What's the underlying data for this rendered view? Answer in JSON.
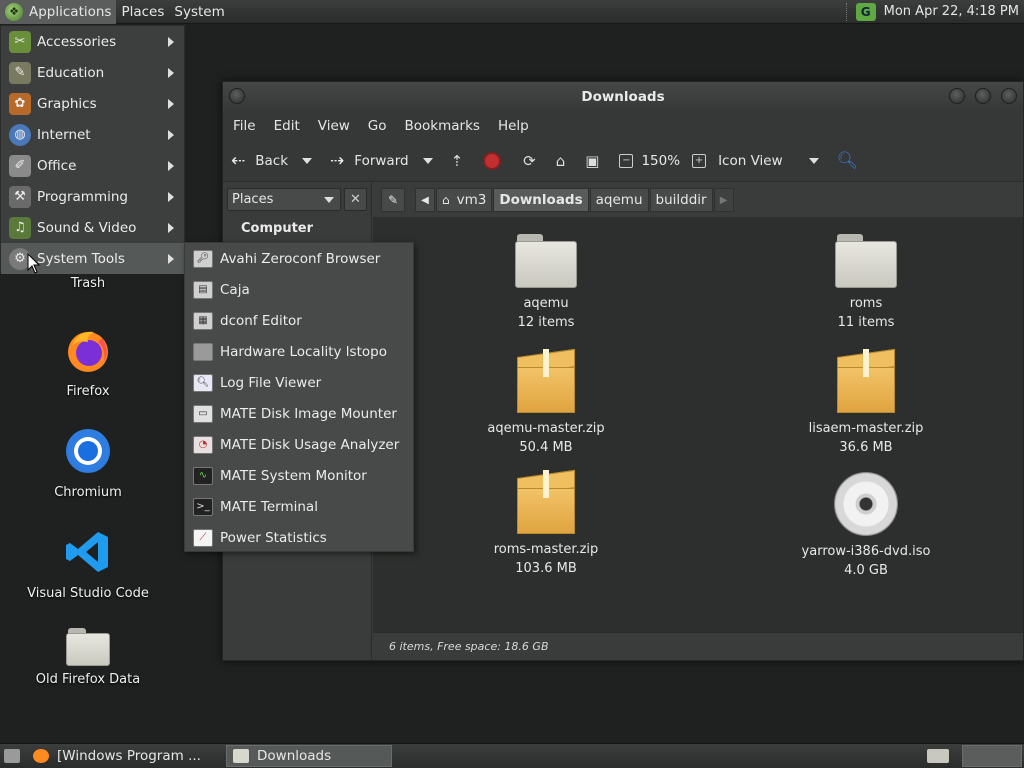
{
  "top_panel": {
    "menus": [
      "Applications",
      "Places",
      "System"
    ],
    "clock": "Mon Apr 22,  4:18 PM"
  },
  "desktop": {
    "icons": [
      {
        "label": "Trash"
      },
      {
        "label": "Firefox"
      },
      {
        "label": "Chromium"
      },
      {
        "label": "Visual Studio Code"
      },
      {
        "label": "Old Firefox Data"
      }
    ]
  },
  "app_menu": {
    "items": [
      {
        "label": "Accessories",
        "icon": "accessories-icon"
      },
      {
        "label": "Education",
        "icon": "education-icon"
      },
      {
        "label": "Graphics",
        "icon": "graphics-icon"
      },
      {
        "label": "Internet",
        "icon": "internet-icon"
      },
      {
        "label": "Office",
        "icon": "office-icon"
      },
      {
        "label": "Programming",
        "icon": "programming-icon"
      },
      {
        "label": "Sound & Video",
        "icon": "sound-video-icon"
      },
      {
        "label": "System Tools",
        "icon": "gear-icon"
      }
    ],
    "active_index": 7
  },
  "system_tools_menu": {
    "items": [
      "Avahi Zeroconf Browser",
      "Caja",
      "dconf Editor",
      "Hardware Locality lstopo",
      "Log File Viewer",
      "MATE Disk Image Mounter",
      "MATE Disk Usage Analyzer",
      "MATE System Monitor",
      "MATE Terminal",
      "Power Statistics"
    ]
  },
  "window": {
    "title": "Downloads",
    "menubar": [
      "File",
      "Edit",
      "View",
      "Go",
      "Bookmarks",
      "Help"
    ],
    "toolbar": {
      "back": "Back",
      "forward": "Forward",
      "zoom": "150%",
      "view_mode": "Icon View"
    },
    "sidepane": {
      "selector": "Places",
      "heading": "Computer"
    },
    "pathbar": [
      "vm3",
      "Downloads",
      "aqemu",
      "builddir"
    ],
    "current_path_index": 1,
    "files": [
      {
        "name": "aqemu",
        "info": "12 items",
        "kind": "folder"
      },
      {
        "name": "roms",
        "info": "11 items",
        "kind": "folder"
      },
      {
        "name": "aqemu-master.zip",
        "info": "50.4 MB",
        "kind": "archive"
      },
      {
        "name": "lisaem-master.zip",
        "info": "36.6 MB",
        "kind": "archive"
      },
      {
        "name": "roms-master.zip",
        "info": "103.6 MB",
        "kind": "archive"
      },
      {
        "name": "yarrow-i386-dvd.iso",
        "info": "4.0 GB",
        "kind": "disc"
      }
    ],
    "status": "6 items, Free space: 18.6 GB"
  },
  "bottom_panel": {
    "tasks": [
      "[Windows Program ...",
      "Downloads"
    ]
  },
  "colors": {
    "panel": "#2f3231",
    "menu_bg": "#3c3f3e",
    "submenu_bg": "#474a49",
    "icon_view_bg": "#2d2f2e",
    "stop": "#c03030",
    "accent_green": "#5fa844"
  }
}
